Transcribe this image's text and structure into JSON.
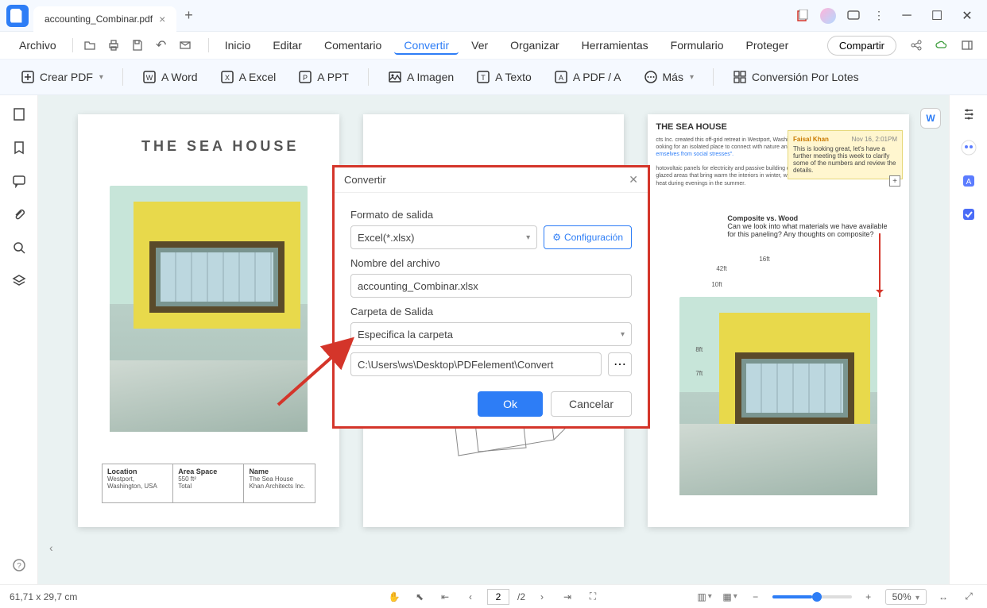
{
  "titlebar": {
    "tab_name": "accounting_Combinar.pdf"
  },
  "menu": {
    "file": "Archivo",
    "items": [
      "Inicio",
      "Editar",
      "Comentario",
      "Convertir",
      "Ver",
      "Organizar",
      "Herramientas",
      "Formulario",
      "Proteger"
    ],
    "active_index": 3,
    "share": "Compartir"
  },
  "toolbar": {
    "create_pdf": "Crear PDF",
    "a_word": "A Word",
    "a_excel": "A Excel",
    "a_ppt": "A PPT",
    "a_imagen": "A Imagen",
    "a_texto": "A Texto",
    "a_pdfa": "A PDF / A",
    "mas": "Más",
    "batch": "Conversión Por Lotes"
  },
  "page1": {
    "title": "THE SEA HOUSE",
    "table": {
      "h1": "Location",
      "v1a": "Westport,",
      "v1b": "Washington, USA",
      "h2": "Area Space",
      "v2a": "550 ft²",
      "v2b": "Total",
      "h3": "Name",
      "v3a": "The Sea House",
      "v3b": "Khan Architects Inc."
    }
  },
  "page3": {
    "title": "THE SEA HOUSE",
    "body1": "cts Inc. created this off-grid retreat in Westport, Washington",
    "body2": "ooking for an isolated place to connect with nature and",
    "link": "emselves from social stresses\".",
    "body3": "hotovoltaic panels for electricity and passive building designs its internal temperature. This includes glazed areas that bring warm the interiors in winter, while an extended west-facing shade from solar heat during evenings in the summer.",
    "note": {
      "author": "Faisal Khan",
      "date": "Nov 16, 2:01PM",
      "text": "This is looking great, let's have a further meeting this week to clarify some of the numbers and review the details."
    },
    "anno_title": "Composite vs. Wood",
    "anno_text": "Can we look into what materials we have available for this paneling? Any thoughts on composite?",
    "labels": {
      "l16": "16ft",
      "l10": "10ft",
      "l8": "8ft",
      "l7": "7ft",
      "l42": "42ft"
    }
  },
  "dialog": {
    "title": "Convertir",
    "format_label": "Formato de salida",
    "format_value": "Excel(*.xlsx)",
    "config": "Configuración",
    "name_label": "Nombre del archivo",
    "name_value": "accounting_Combinar.xlsx",
    "folder_label": "Carpeta de Salida",
    "folder_select": "Especifica la carpeta",
    "folder_path": "C:\\Users\\ws\\Desktop\\PDFelement\\Convert",
    "ok": "Ok",
    "cancel": "Cancelar"
  },
  "status": {
    "dims": "61,71 x 29,7 cm",
    "page_current": "2",
    "page_total": "/2",
    "zoom": "50%"
  }
}
